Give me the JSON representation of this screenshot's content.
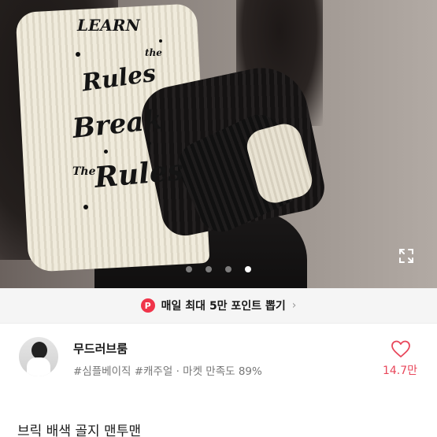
{
  "product_image": {
    "alt": "product photo",
    "print_lines": [
      "LEARN",
      "the",
      "Rules",
      "Break",
      "The",
      "Rules"
    ],
    "carousel": {
      "total": 4,
      "active_index": 3
    }
  },
  "promo": {
    "badge": "P",
    "text": "매일 최대 5만 포인트 뽑기",
    "chevron": "›"
  },
  "seller": {
    "name": "무드러브룸",
    "meta": "#심플베이직 #캐주얼 · 마켓 만족도 89%"
  },
  "likes": {
    "count": "14.7만"
  },
  "product": {
    "title": "브릭 배색 골지 맨투맨"
  },
  "colors": {
    "accent_red": "#f0344a",
    "like_red": "#e8475b",
    "banner_bg": "#f5f5f5"
  },
  "icons": [
    "expand-icon",
    "heart-icon",
    "chevron-right-icon"
  ]
}
